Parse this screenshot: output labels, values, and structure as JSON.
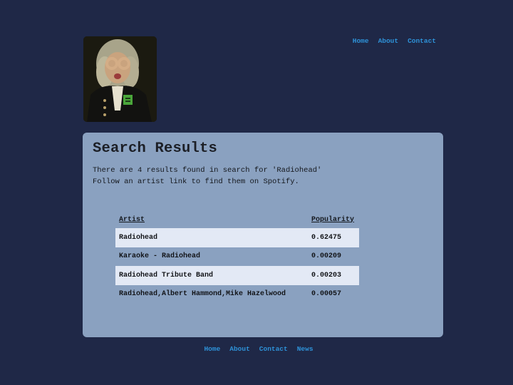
{
  "header": {
    "nav": [
      "Home",
      "About",
      "Contact"
    ]
  },
  "search": {
    "title": "Search Results",
    "summary_line1": "There are 4 results found in search for 'Radiohead'",
    "summary_line2": "Follow an artist link to find them on Spotify."
  },
  "results_table": {
    "columns": [
      "Artist",
      "Popularity"
    ],
    "rows": [
      {
        "artist": "Radiohead",
        "popularity": "0.62475"
      },
      {
        "artist": "Karaoke - Radiohead",
        "popularity": "0.00209"
      },
      {
        "artist": "Radiohead Tribute Band",
        "popularity": "0.00203"
      },
      {
        "artist": "Radiohead,Albert Hammond,Mike Hazelwood",
        "popularity": "0.00057"
      }
    ]
  },
  "footer": {
    "nav": [
      "Home",
      "About",
      "Contact",
      "News"
    ]
  },
  "colors": {
    "background": "#1f2847",
    "panel": "#8aa1c0",
    "row_highlight": "#e3e9f5",
    "link": "#2e92d8"
  }
}
